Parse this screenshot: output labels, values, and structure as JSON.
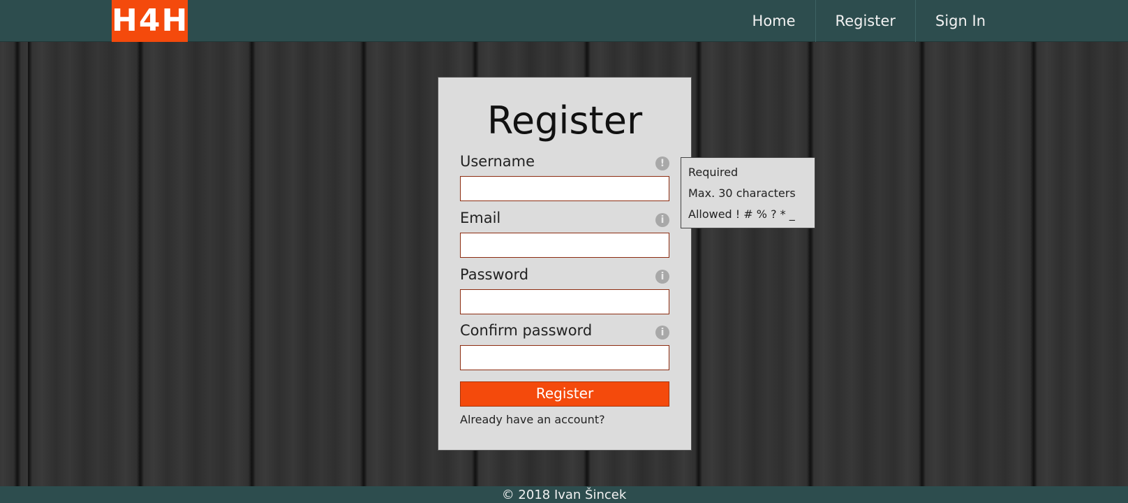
{
  "header": {
    "logo_text": "H4H",
    "nav": [
      {
        "label": "Home"
      },
      {
        "label": "Register"
      },
      {
        "label": "Sign In"
      }
    ]
  },
  "form": {
    "title": "Register",
    "fields": [
      {
        "label": "Username",
        "icon": "!",
        "icon_name": "warning-icon",
        "value": ""
      },
      {
        "label": "Email",
        "icon": "i",
        "icon_name": "info-icon",
        "value": ""
      },
      {
        "label": "Password",
        "icon": "i",
        "icon_name": "info-icon",
        "value": ""
      },
      {
        "label": "Confirm password",
        "icon": "i",
        "icon_name": "info-icon",
        "value": ""
      }
    ],
    "submit_label": "Register",
    "login_link": "Already have an account?"
  },
  "tooltip": {
    "lines": [
      "Required",
      "Max. 30 characters",
      "Allowed ! # % ? * _"
    ]
  },
  "footer": {
    "text": "© 2018 Ivan Šincek"
  },
  "colors": {
    "header_bg": "#2d4d4e",
    "accent": "#f44a0c",
    "card_bg": "#dcdcdc",
    "input_border": "#8c2c10"
  }
}
